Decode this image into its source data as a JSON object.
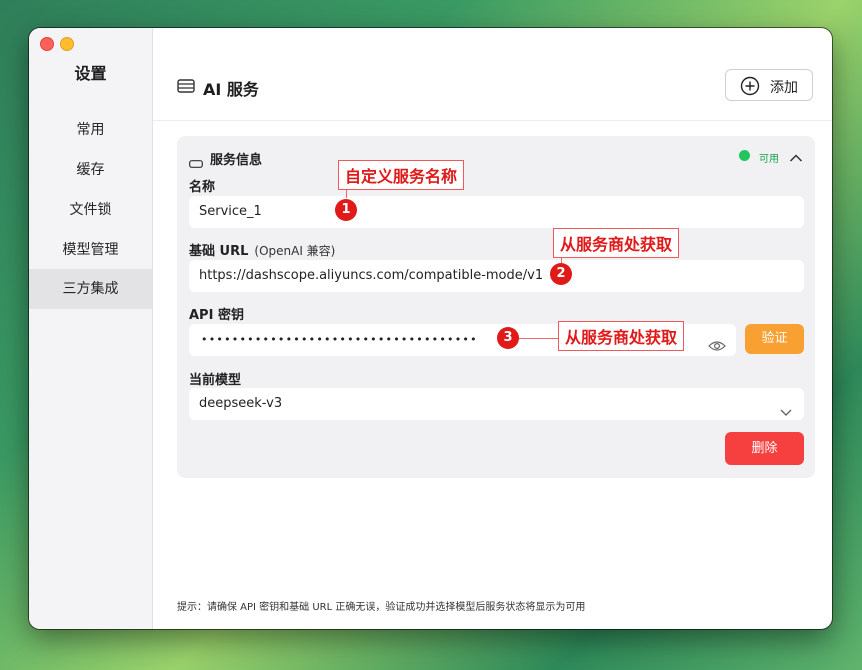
{
  "sidebar": {
    "title": "设置",
    "items": [
      {
        "label": "常用"
      },
      {
        "label": "缓存"
      },
      {
        "label": "文件锁"
      },
      {
        "label": "模型管理"
      },
      {
        "label": "三方集成"
      }
    ],
    "active_item": "三方集成"
  },
  "header": {
    "title": "AI 服务",
    "add_label": "添加"
  },
  "service_card": {
    "title": "服务信息",
    "status": "可用",
    "status_color": "#22c55e",
    "name_label": "名称",
    "name_value": "Service_1",
    "base_url_label": "基础 URL",
    "base_url_hint": "(OpenAI 兼容)",
    "base_url_value": "https://dashscope.aliyuncs.com/compatible-mode/v1",
    "api_key_label": "API 密钥",
    "api_key_masked": "••••••••••••••••••••••••••••••••••••",
    "verify_label": "验证",
    "model_label": "当前模型",
    "model_value": "deepseek-v3",
    "delete_label": "删除"
  },
  "footer_tip": "提示：请确保 API 密钥和基础 URL 正确无误，验证成功并选择模型后服务状态将显示为可用",
  "annotations": [
    {
      "number": "1",
      "text": "自定义服务名称"
    },
    {
      "number": "2",
      "text": "从服务商处获取"
    },
    {
      "number": "3",
      "text": "从服务商处获取"
    }
  ],
  "colors": {
    "accent_orange": "#f8a032",
    "danger_red": "#f64040",
    "annotation_red": "#e01919"
  }
}
